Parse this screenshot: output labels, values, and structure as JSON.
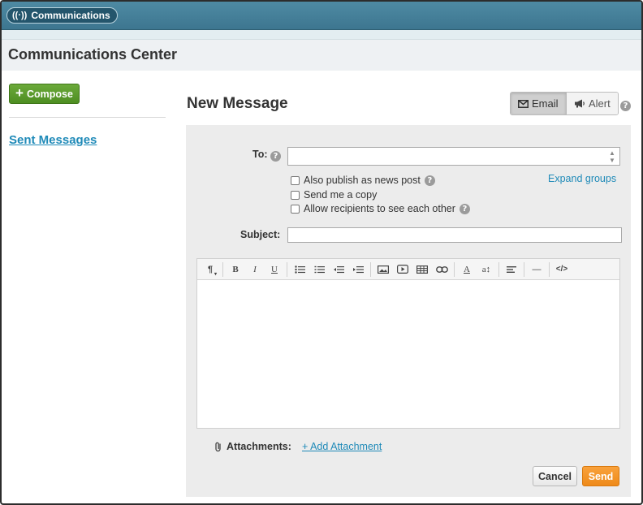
{
  "app": {
    "name": "Communications",
    "icon": "antenna-icon"
  },
  "page": {
    "title": "Communications Center"
  },
  "sidebar": {
    "compose_label": "Compose",
    "sent_messages_label": "Sent Messages"
  },
  "compose": {
    "title": "New Message",
    "mode_toggle": {
      "email_label": "Email",
      "alert_label": "Alert",
      "selected": "Email"
    },
    "to_label": "To:",
    "to_value": "",
    "options": [
      {
        "label": "Also publish as news post",
        "checked": false,
        "has_help": true
      },
      {
        "label": "Send me a copy",
        "checked": false,
        "has_help": false
      },
      {
        "label": "Allow recipients to see each other",
        "checked": false,
        "has_help": true
      }
    ],
    "expand_groups_label": "Expand groups",
    "subject_label": "Subject:",
    "subject_value": "",
    "editor_toolbar": [
      "paragraph-icon",
      "bold-icon",
      "italic-icon",
      "underline-icon",
      "bullet-list-icon",
      "numbered-list-icon",
      "outdent-icon",
      "indent-icon",
      "image-icon",
      "video-icon",
      "table-icon",
      "link-icon",
      "font-color-icon",
      "font-size-icon",
      "align-icon",
      "horizontal-rule-icon",
      "code-view-icon"
    ],
    "body_value": "",
    "attachments_label": "Attachments:",
    "add_attachment_label": "+ Add Attachment",
    "cancel_label": "Cancel",
    "send_label": "Send"
  },
  "colors": {
    "topbar": "#3d7690",
    "compose_button": "#5a9a2c",
    "link": "#1f8ab8",
    "send_button": "#f29326"
  }
}
